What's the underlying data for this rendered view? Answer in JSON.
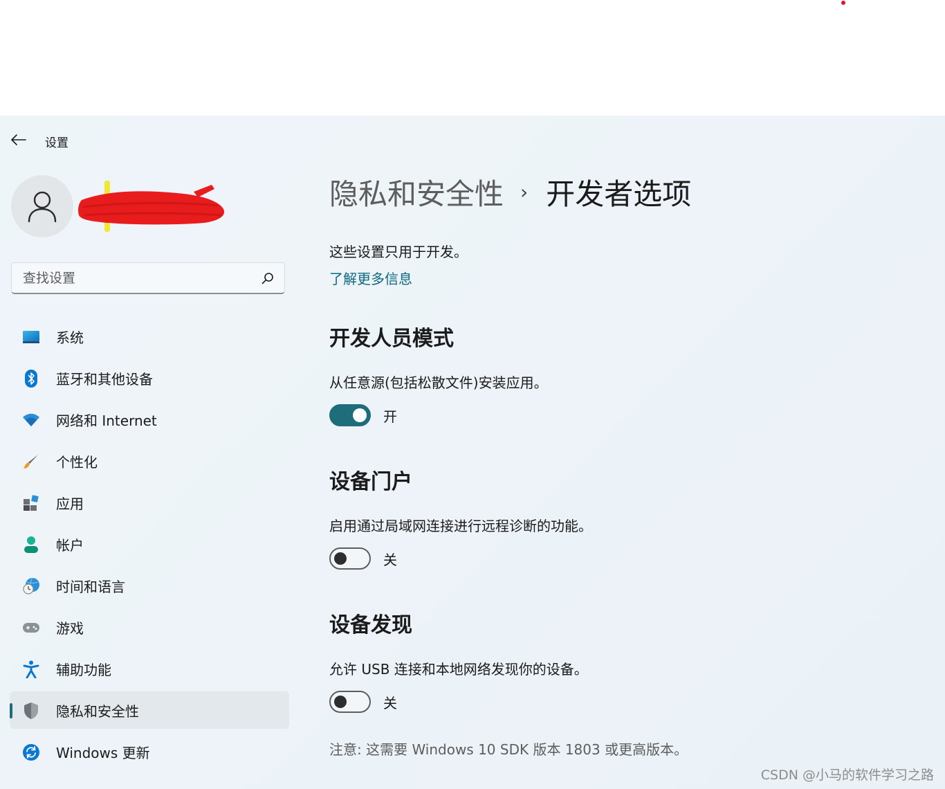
{
  "window": {
    "title": "设置"
  },
  "search": {
    "placeholder": "查找设置"
  },
  "sidebar": {
    "items": [
      {
        "label": "系统",
        "icon": "system-icon"
      },
      {
        "label": "蓝牙和其他设备",
        "icon": "bluetooth-icon"
      },
      {
        "label": "网络和 Internet",
        "icon": "wifi-icon"
      },
      {
        "label": "个性化",
        "icon": "brush-icon"
      },
      {
        "label": "应用",
        "icon": "apps-icon"
      },
      {
        "label": "帐户",
        "icon": "account-icon"
      },
      {
        "label": "时间和语言",
        "icon": "time-language-icon"
      },
      {
        "label": "游戏",
        "icon": "gamepad-icon"
      },
      {
        "label": "辅助功能",
        "icon": "accessibility-icon"
      },
      {
        "label": "隐私和安全性",
        "icon": "shield-icon",
        "selected": true
      },
      {
        "label": "Windows 更新",
        "icon": "update-icon"
      }
    ]
  },
  "breadcrumb": {
    "parent": "隐私和安全性",
    "separator": "›",
    "current": "开发者选项"
  },
  "intro": {
    "text": "这些设置只用于开发。",
    "link": "了解更多信息"
  },
  "sections": [
    {
      "title": "开发人员模式",
      "description": "从任意源(包括松散文件)安装应用。",
      "toggle_on": true,
      "state_label": "开"
    },
    {
      "title": "设备门户",
      "description": "启用通过局域网连接进行远程诊断的功能。",
      "toggle_on": false,
      "state_label": "关"
    },
    {
      "title": "设备发现",
      "description": "允许 USB 连接和本地网络发现你的设备。",
      "toggle_on": false,
      "state_label": "关"
    }
  ],
  "note": "注意: 这需要 Windows 10 SDK 版本 1803 或更高版本。",
  "watermark": "CSDN @小马的软件学习之路",
  "colors": {
    "accent": "#1d6d7a",
    "link": "#0e6a80",
    "redaction": "#e81c1c"
  }
}
